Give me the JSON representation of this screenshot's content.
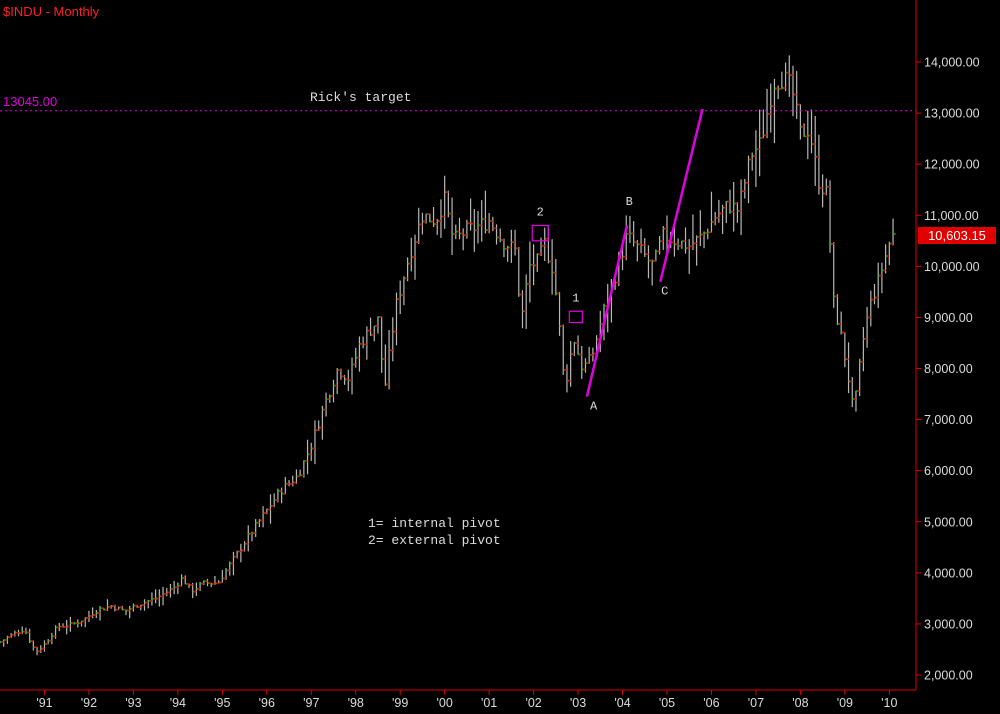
{
  "chart_title": "$INDU - Monthly",
  "colors": {
    "background": "#000000",
    "axis": "#e00000",
    "bar": "#b8b8b8",
    "open_tick": "#e00000",
    "close_tick": "#00c000",
    "annotation": "#e000e0",
    "label": "#dcdcdc",
    "title": "#ff2020"
  },
  "target": {
    "label": "13045.00",
    "value": 13045,
    "caption": "Rick's target"
  },
  "last_price": {
    "label": "10,603.15",
    "value": 10603.15
  },
  "legend_notes": [
    "1= internal pivot",
    "2= external pivot"
  ],
  "chart_data": {
    "type": "ohlc",
    "title": "$INDU - Monthly",
    "y_axis_side": "right",
    "ylim": [
      1700,
      14800
    ],
    "y_ticks": [
      {
        "value": 2000,
        "label": "2,000.00"
      },
      {
        "value": 3000,
        "label": "3,000.00"
      },
      {
        "value": 4000,
        "label": "4,000.00"
      },
      {
        "value": 5000,
        "label": "5,000.00"
      },
      {
        "value": 6000,
        "label": "6,000.00"
      },
      {
        "value": 7000,
        "label": "7,000.00"
      },
      {
        "value": 8000,
        "label": "8,000.00"
      },
      {
        "value": 9000,
        "label": "9,000.00"
      },
      {
        "value": 10000,
        "label": "10,000.00"
      },
      {
        "value": 11000,
        "label": "11,000.00"
      },
      {
        "value": 12000,
        "label": "12,000.00"
      },
      {
        "value": 13000,
        "label": "13,000.00"
      },
      {
        "value": 14000,
        "label": "14,000.00"
      }
    ],
    "x_ticks": [
      {
        "t": 1991.0,
        "label": "'91"
      },
      {
        "t": 1992.0,
        "label": "'92"
      },
      {
        "t": 1993.0,
        "label": "'93"
      },
      {
        "t": 1994.0,
        "label": "'94"
      },
      {
        "t": 1995.0,
        "label": "'95"
      },
      {
        "t": 1996.0,
        "label": "'96"
      },
      {
        "t": 1997.0,
        "label": "'97"
      },
      {
        "t": 1998.0,
        "label": "'98"
      },
      {
        "t": 1999.0,
        "label": "'99"
      },
      {
        "t": 2000.0,
        "label": "'00"
      },
      {
        "t": 2001.0,
        "label": "'01"
      },
      {
        "t": 2002.0,
        "label": "'02"
      },
      {
        "t": 2003.0,
        "label": "'03"
      },
      {
        "t": 2004.0,
        "label": "'04"
      },
      {
        "t": 2005.0,
        "label": "'05"
      },
      {
        "t": 2006.0,
        "label": "'06"
      },
      {
        "t": 2007.0,
        "label": "'07"
      },
      {
        "t": 2008.0,
        "label": "'08"
      },
      {
        "t": 2009.0,
        "label": "'09"
      },
      {
        "t": 2010.0,
        "label": "'10"
      }
    ],
    "x_range": [
      1990.0,
      2010.6
    ],
    "anchors": [
      [
        1990.0,
        2650
      ],
      [
        1990.3,
        2800
      ],
      [
        1990.55,
        2900
      ],
      [
        1990.8,
        2450
      ],
      [
        1991.0,
        2600
      ],
      [
        1991.3,
        2950
      ],
      [
        1991.6,
        2980
      ],
      [
        1991.9,
        3100
      ],
      [
        1992.2,
        3280
      ],
      [
        1992.5,
        3350
      ],
      [
        1992.8,
        3250
      ],
      [
        1993.1,
        3380
      ],
      [
        1993.5,
        3500
      ],
      [
        1993.9,
        3700
      ],
      [
        1994.1,
        3900
      ],
      [
        1994.3,
        3650
      ],
      [
        1994.6,
        3800
      ],
      [
        1994.9,
        3800
      ],
      [
        1995.2,
        4200
      ],
      [
        1995.5,
        4600
      ],
      [
        1995.9,
        5100
      ],
      [
        1996.3,
        5600
      ],
      [
        1996.7,
        5900
      ],
      [
        1997.0,
        6500
      ],
      [
        1997.3,
        7300
      ],
      [
        1997.6,
        8000
      ],
      [
        1997.85,
        7800
      ],
      [
        1998.1,
        8500
      ],
      [
        1998.5,
        8950
      ],
      [
        1998.65,
        7600
      ],
      [
        1998.9,
        9200
      ],
      [
        1999.2,
        10200
      ],
      [
        1999.5,
        11000
      ],
      [
        1999.8,
        10900
      ],
      [
        2000.0,
        11300
      ],
      [
        2000.2,
        10500
      ],
      [
        2000.5,
        10700
      ],
      [
        2000.8,
        10800
      ],
      [
        2001.0,
        10900
      ],
      [
        2001.3,
        10500
      ],
      [
        2001.6,
        10300
      ],
      [
        2001.72,
        8900
      ],
      [
        2001.9,
        10000
      ],
      [
        2002.1,
        10100
      ],
      [
        2002.25,
        10450
      ],
      [
        2002.45,
        9900
      ],
      [
        2002.58,
        8800
      ],
      [
        2002.7,
        7600
      ],
      [
        2002.9,
        8600
      ],
      [
        2003.1,
        8000
      ],
      [
        2003.3,
        8200
      ],
      [
        2003.6,
        9200
      ],
      [
        2003.9,
        10000
      ],
      [
        2004.1,
        10600
      ],
      [
        2004.4,
        10300
      ],
      [
        2004.7,
        10000
      ],
      [
        2004.9,
        10600
      ],
      [
        2005.2,
        10500
      ],
      [
        2005.5,
        10400
      ],
      [
        2005.8,
        10600
      ],
      [
        2006.1,
        11000
      ],
      [
        2006.4,
        11200
      ],
      [
        2006.6,
        11100
      ],
      [
        2006.9,
        12200
      ],
      [
        2007.1,
        12400
      ],
      [
        2007.4,
        13600
      ],
      [
        2007.6,
        13700
      ],
      [
        2007.8,
        13500
      ],
      [
        2008.0,
        12600
      ],
      [
        2008.2,
        12700
      ],
      [
        2008.4,
        11700
      ],
      [
        2008.6,
        11400
      ],
      [
        2008.75,
        9300
      ],
      [
        2008.9,
        8700
      ],
      [
        2009.05,
        8000
      ],
      [
        2009.2,
        7100
      ],
      [
        2009.4,
        8500
      ],
      [
        2009.55,
        9200
      ],
      [
        2009.75,
        9700
      ],
      [
        2010.0,
        10450
      ],
      [
        2010.05,
        10603
      ]
    ],
    "reference_line": {
      "value": 13045,
      "style": "dotted"
    },
    "trend_lines": [
      {
        "from": [
          2003.2,
          7450
        ],
        "to": [
          2004.1,
          10800
        ]
      },
      {
        "from": [
          2004.85,
          9700
        ],
        "to": [
          2005.8,
          13080
        ]
      }
    ],
    "pivot_boxes": [
      {
        "label": "2",
        "t": 2002.15,
        "y_low": 10500,
        "y_high": 10800
      },
      {
        "label": "1",
        "t": 2002.95,
        "y_low": 8900,
        "y_high": 9120
      }
    ],
    "point_labels": [
      {
        "label": "A",
        "t": 2003.35,
        "value": 7200
      },
      {
        "label": "B",
        "t": 2004.15,
        "value": 11200
      },
      {
        "label": "C",
        "t": 2004.95,
        "value": 9450
      }
    ]
  }
}
